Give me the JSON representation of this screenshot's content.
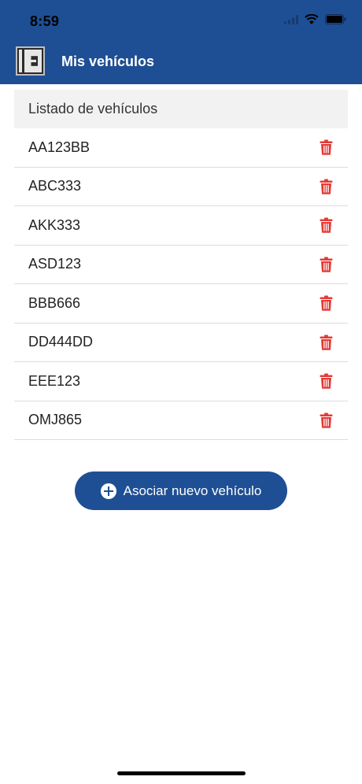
{
  "status_bar": {
    "time": "8:59"
  },
  "app_bar": {
    "logo_letter": "E",
    "title": "Mis vehículos"
  },
  "list": {
    "header": "Listado de vehículos",
    "vehicles": [
      "AA123BB",
      "ABC333",
      "AKK333",
      "ASD123",
      "BBB666",
      "DD444DD",
      "EEE123",
      "OMJ865"
    ]
  },
  "add_button": {
    "label": "Asociar nuevo vehículo"
  },
  "colors": {
    "primary": "#1e4f94",
    "delete": "#e53935",
    "header_bg": "#f2f2f2"
  },
  "icons": {
    "delete": "trash-icon",
    "add": "plus-circle-icon"
  }
}
